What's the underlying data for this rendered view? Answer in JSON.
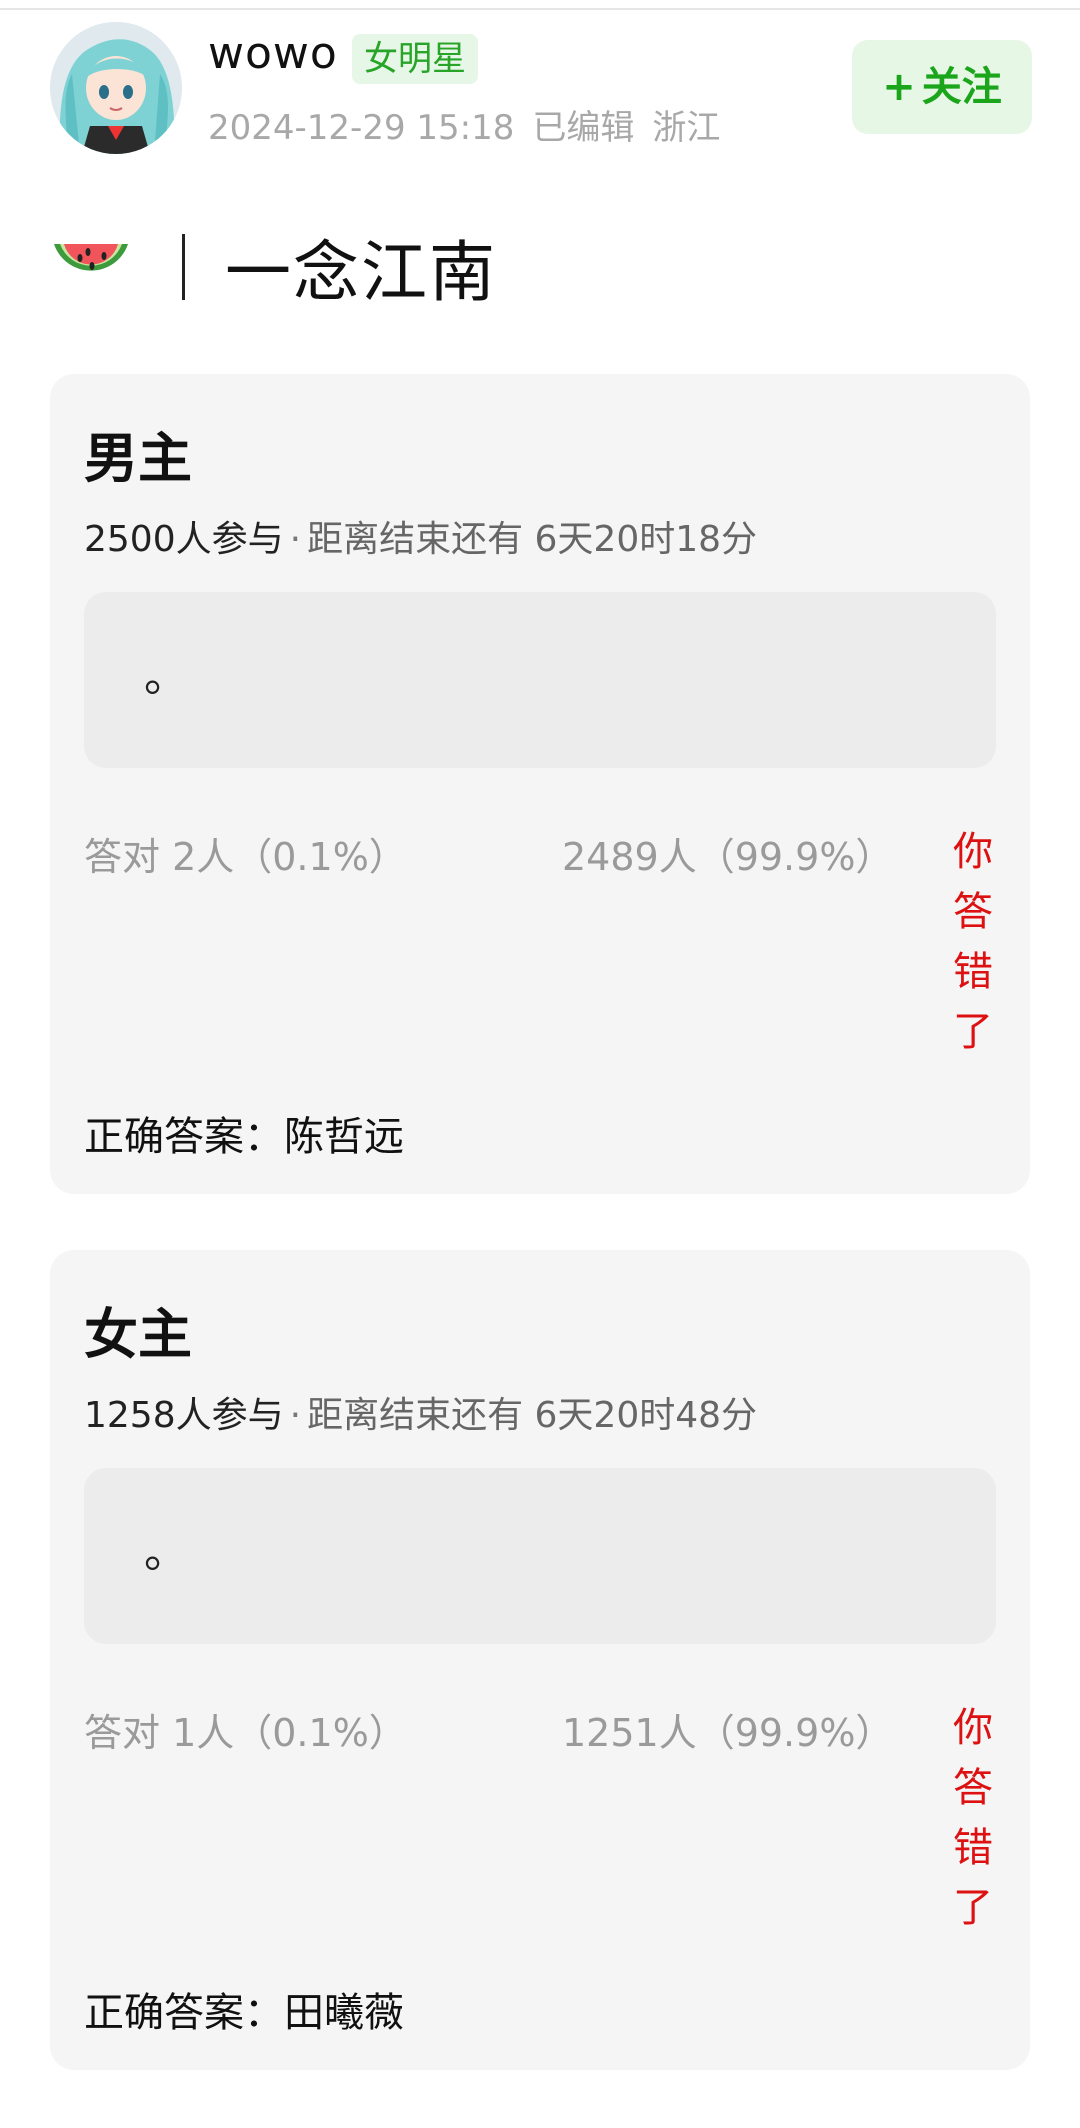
{
  "header": {
    "username": "wowo",
    "badge": "女明星",
    "date": "2024-12-29 15:18",
    "edited": "已编辑",
    "location": "浙江",
    "follow_plus": "+",
    "follow_label": "关注",
    "avatar_icon": "anime-avatar-icon"
  },
  "post": {
    "title_icon": "watermelon-icon",
    "title": "一念江南"
  },
  "cards": [
    {
      "question": "男主",
      "participants": "2500人参与",
      "separator": "·",
      "remaining": "距离结束还有 6天20时18分",
      "option_text": "。",
      "correct_stat": "答对  2人（0.1%）",
      "wrong_stat": "2489人（99.9%）",
      "wrong_label": "你答错了",
      "correct_answer": "正确答案：陈哲远"
    },
    {
      "question": "女主",
      "participants": "1258人参与",
      "separator": "·",
      "remaining": "距离结束还有 6天20时48分",
      "option_text": "。",
      "correct_stat": "答对  1人（0.1%）",
      "wrong_stat": "1251人（99.9%）",
      "wrong_label": "你答错了",
      "correct_answer": "正确答案：田曦薇"
    }
  ],
  "colors": {
    "accent_green": "#1aa51a",
    "badge_bg": "#e7f7e7",
    "wrong_red": "#d11",
    "card_bg": "#f5f5f5"
  }
}
